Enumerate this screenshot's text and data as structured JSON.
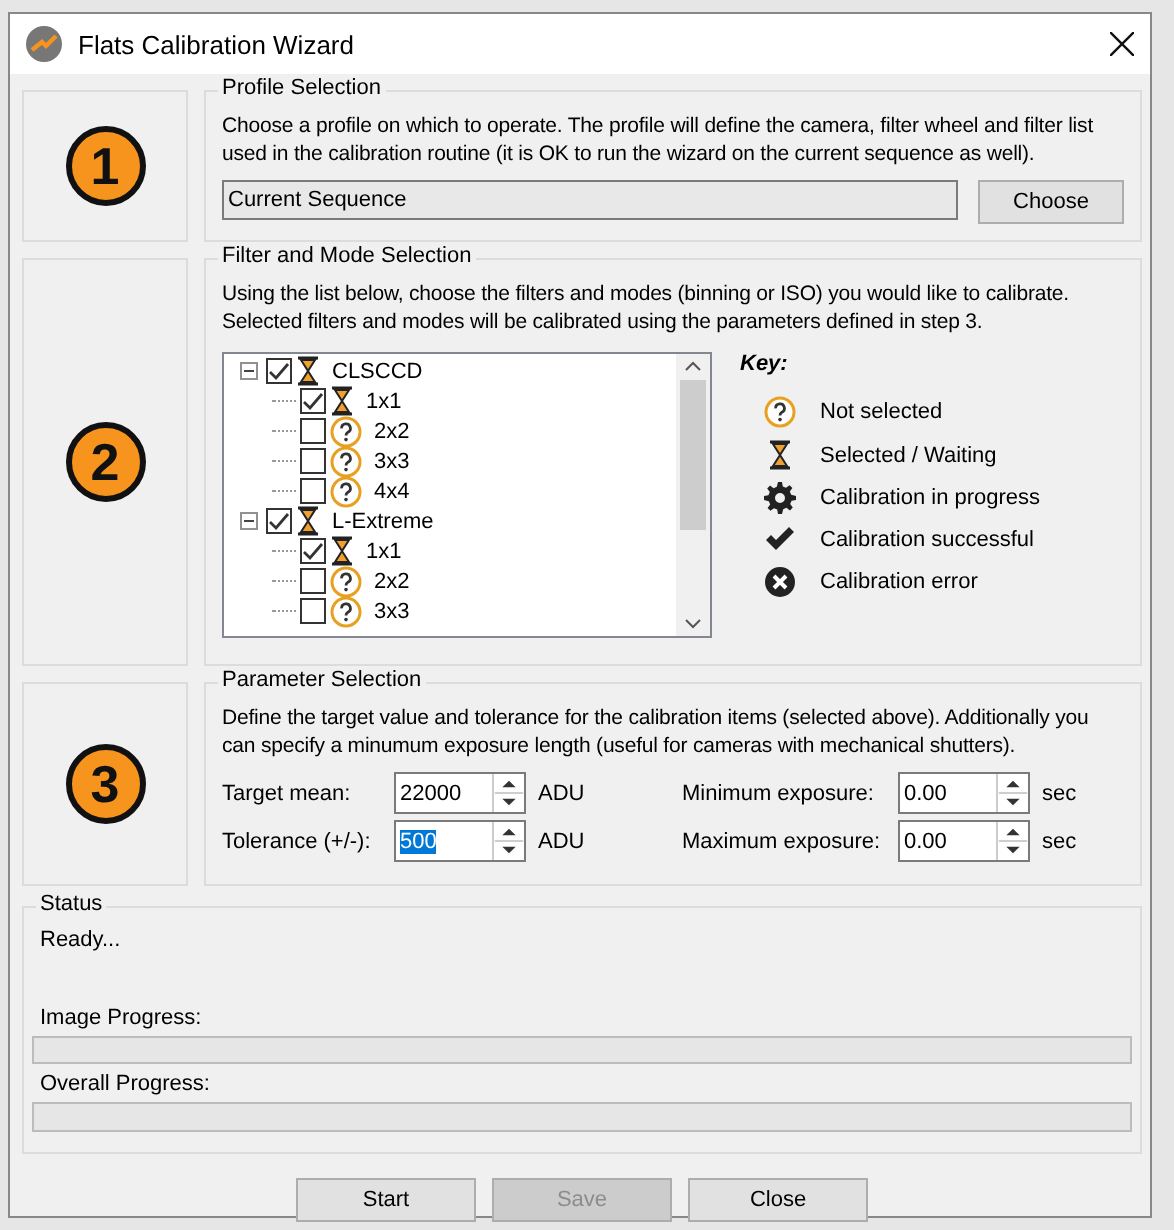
{
  "window": {
    "title": "Flats Calibration Wizard"
  },
  "steps": [
    {
      "number": "1"
    },
    {
      "number": "2"
    },
    {
      "number": "3"
    }
  ],
  "profile": {
    "title": "Profile Selection",
    "description": "Choose a profile on which to operate.  The profile will define the camera, filter wheel and filter list used in the calibration routine (it is OK to run the wizard on the current sequence as well).",
    "value": "Current Sequence",
    "button": "Choose"
  },
  "filters": {
    "title": "Filter and Mode Selection",
    "description": "Using the list below, choose the filters and modes (binning or ISO) you would like to calibrate. Selected filters and modes will be calibrated using the parameters defined in step 3.",
    "tree": [
      {
        "label": "CLSCCD",
        "checked": true,
        "expanded": true,
        "kind": "waiting",
        "children": [
          {
            "label": "1x1",
            "checked": true,
            "kind": "waiting"
          },
          {
            "label": "2x2",
            "checked": false,
            "kind": "unselected"
          },
          {
            "label": "3x3",
            "checked": false,
            "kind": "unselected"
          },
          {
            "label": "4x4",
            "checked": false,
            "kind": "unselected"
          }
        ]
      },
      {
        "label": "L-Extreme",
        "checked": true,
        "expanded": true,
        "kind": "waiting",
        "children": [
          {
            "label": "1x1",
            "checked": true,
            "kind": "waiting"
          },
          {
            "label": "2x2",
            "checked": false,
            "kind": "unselected"
          },
          {
            "label": "3x3",
            "checked": false,
            "kind": "unselected"
          }
        ]
      }
    ],
    "key_title": "Key:",
    "key": [
      {
        "kind": "unselected",
        "label": "Not selected"
      },
      {
        "kind": "waiting",
        "label": "Selected / Waiting"
      },
      {
        "kind": "progress",
        "label": "Calibration in progress"
      },
      {
        "kind": "success",
        "label": "Calibration successful"
      },
      {
        "kind": "error",
        "label": "Calibration error"
      }
    ]
  },
  "parameters": {
    "title": "Parameter Selection",
    "description": "Define the target value and tolerance for the calibration items (selected above).  Additionally you can specify a minumum exposure length (useful for cameras with mechanical shutters).",
    "fields": [
      {
        "label": "Target mean:",
        "value": "22000",
        "unit": "ADU",
        "text_selected": false
      },
      {
        "label": "Minimum exposure:",
        "value": "0.00",
        "unit": "sec",
        "text_selected": false
      },
      {
        "label": "Tolerance (+/-):",
        "value": "500",
        "unit": "ADU",
        "text_selected": true
      },
      {
        "label": "Maximum exposure:",
        "value": "0.00",
        "unit": "sec",
        "text_selected": false
      }
    ]
  },
  "status": {
    "title": "Status",
    "message": "Ready...",
    "progress": [
      {
        "label": "Image Progress:",
        "level": 0
      },
      {
        "label": "Overall Progress:",
        "level": 0
      }
    ]
  },
  "buttons": [
    {
      "label": "Start",
      "disabled": false
    },
    {
      "label": "Save",
      "disabled": true
    },
    {
      "label": "Close",
      "disabled": false
    }
  ]
}
